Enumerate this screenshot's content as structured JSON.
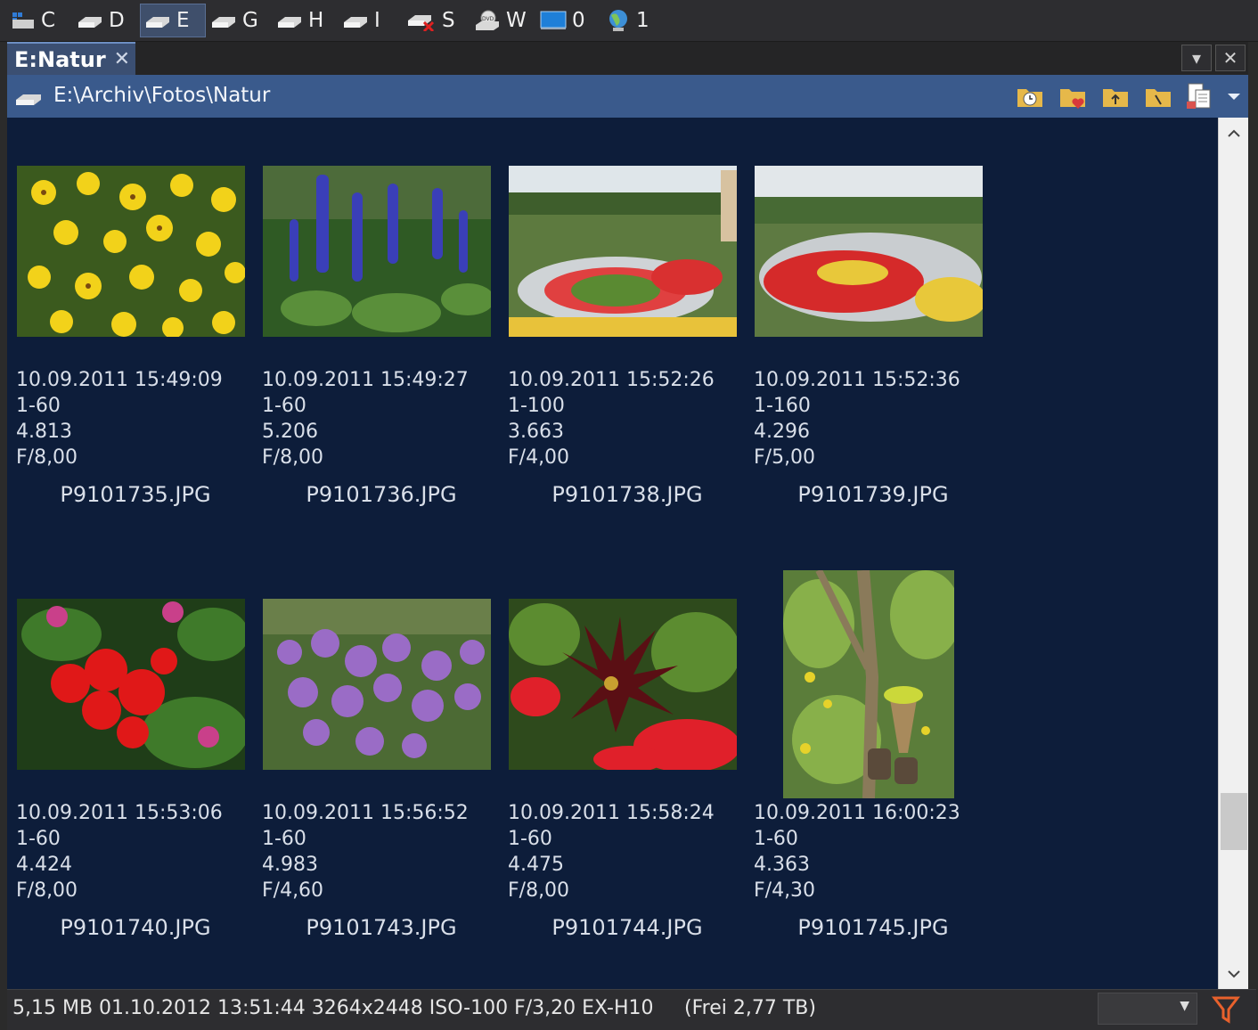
{
  "drives": [
    {
      "label": "C",
      "icon": "windows-drive-icon"
    },
    {
      "label": "D",
      "icon": "drive-icon"
    },
    {
      "label": "E",
      "icon": "drive-icon",
      "active": true
    },
    {
      "label": "G",
      "icon": "drive-icon"
    },
    {
      "label": "H",
      "icon": "drive-icon"
    },
    {
      "label": "I",
      "icon": "drive-icon"
    },
    {
      "label": "S",
      "icon": "network-drive-disconnected-icon"
    },
    {
      "label": "W",
      "icon": "dvd-drive-icon"
    },
    {
      "label": "0",
      "icon": "desktop-icon"
    },
    {
      "label": "1",
      "icon": "network-globe-icon"
    }
  ],
  "tab": {
    "title": "E:Natur",
    "close": "✕"
  },
  "window_buttons": {
    "menu": "▾",
    "close": "✕"
  },
  "path": {
    "text": "E:\\Archiv\\Fotos\\Natur"
  },
  "path_toolbar_icons": [
    "history-folder-icon",
    "favorite-folder-icon",
    "parent-folder-icon",
    "root-folder-icon",
    "copy-paths-icon",
    "dropdown-icon"
  ],
  "files": [
    {
      "date": "10.09.2011 15:49:09",
      "exposure": "1-60",
      "size": "4.813",
      "aperture": "F/8,00",
      "name": "P9101735.JPG"
    },
    {
      "date": "10.09.2011 15:49:27",
      "exposure": "1-60",
      "size": "5.206",
      "aperture": "F/8,00",
      "name": "P9101736.JPG"
    },
    {
      "date": "10.09.2011 15:52:26",
      "exposure": "1-100",
      "size": "3.663",
      "aperture": "F/4,00",
      "name": "P9101738.JPG"
    },
    {
      "date": "10.09.2011 15:52:36",
      "exposure": "1-160",
      "size": "4.296",
      "aperture": "F/5,00",
      "name": "P9101739.JPG"
    },
    {
      "date": "10.09.2011 15:53:06",
      "exposure": "1-60",
      "size": "4.424",
      "aperture": "F/8,00",
      "name": "P9101740.JPG"
    },
    {
      "date": "10.09.2011 15:56:52",
      "exposure": "1-60",
      "size": "4.983",
      "aperture": "F/4,60",
      "name": "P9101743.JPG"
    },
    {
      "date": "10.09.2011 15:58:24",
      "exposure": "1-60",
      "size": "4.475",
      "aperture": "F/8,00",
      "name": "P9101744.JPG"
    },
    {
      "date": "10.09.2011 16:00:23",
      "exposure": "1-60",
      "size": "4.363",
      "aperture": "F/4,30",
      "name": "P9101745.JPG"
    }
  ],
  "status": {
    "info": "5,15 MB 01.10.2012 13:51:44 3264x2448 ISO-100 F/3,20 EX-H10",
    "free": "(Frei 2,77 TB)"
  },
  "colors": {
    "accent": "#3a5a8c",
    "content_bg": "#0d1d3a",
    "filter": "#e8612c"
  }
}
